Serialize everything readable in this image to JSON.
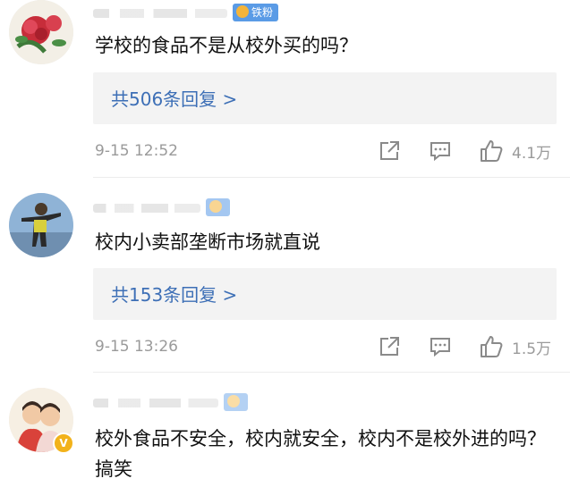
{
  "comments": [
    {
      "fan_label": "铁粉",
      "text": "学校的食品不是从校外买的吗？",
      "reply_label": "共506条回复 >",
      "time": "9-15 12:52",
      "likes": "4.1万"
    },
    {
      "fan_label": "",
      "text": "校内小卖部垄断市场就直说",
      "reply_label": "共153条回复 >",
      "time": "9-15 13:26",
      "likes": "1.5万"
    },
    {
      "fan_label": "",
      "verified_badge": "V",
      "text": "校外食品不安全，校内就安全，校内不是校外进的吗？搞笑"
    }
  ],
  "icons": {
    "share": "share-icon",
    "comment": "comment-icon",
    "like": "thumbs-up-icon"
  },
  "colors": {
    "reply_link": "#3d6fb6",
    "fan_badge": "#5a9be6",
    "meta_text": "#9a9a9a",
    "reply_bg": "#f3f3f3"
  }
}
